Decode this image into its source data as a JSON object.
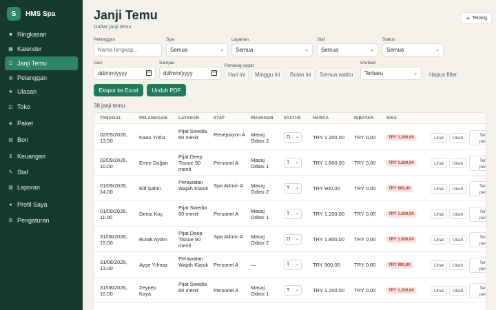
{
  "app": {
    "logo_letter": "S",
    "name": "HMS Spa"
  },
  "sidebar": {
    "items": [
      {
        "label": "Ringkasan",
        "icon": "■",
        "active": false
      },
      {
        "label": "Kalender",
        "icon": "▦",
        "active": false
      },
      {
        "label": "Janji Temu",
        "icon": "☰",
        "active": true
      },
      {
        "label": "Pelanggan",
        "icon": "◍",
        "active": false
      },
      {
        "label": "Ulasan",
        "icon": "★",
        "active": false
      },
      {
        "label": "Toko",
        "icon": "◫",
        "active": false
      },
      {
        "label": "Paket",
        "icon": "◈",
        "active": false
      },
      {
        "label": "Bon",
        "icon": "▤",
        "active": false
      },
      {
        "label": "Keuangan",
        "icon": "$",
        "active": false
      },
      {
        "label": "Staf",
        "icon": "✎",
        "active": false
      },
      {
        "label": "Laporan",
        "icon": "▥",
        "active": false
      },
      {
        "label": "Profil Saya",
        "icon": "●",
        "active": false
      },
      {
        "label": "Pengaturan",
        "icon": "⚙",
        "active": false
      }
    ]
  },
  "header": {
    "title": "Janji Temu",
    "subtitle": "Daftar janji temu",
    "theme_label": "Terang",
    "theme_icon": "☀"
  },
  "filters": {
    "pelanggan": {
      "label": "Pelanggan",
      "placeholder": "Nama lengkap..."
    },
    "spa": {
      "label": "Spa",
      "value": "Semua"
    },
    "layanan": {
      "label": "Layanan",
      "value": "Semua"
    },
    "staf": {
      "label": "Staf",
      "value": "Semua"
    },
    "status": {
      "label": "Status",
      "value": "Semua"
    },
    "dari": {
      "label": "Dari",
      "value": "dd/mm/yyyy"
    },
    "sampai": {
      "label": "Sampai",
      "value": "dd/mm/yyyy"
    },
    "rentang": {
      "label": "Rentang cepat",
      "options": [
        "Hari ini",
        "Minggu ini",
        "Bulan ini",
        "Semua waktu"
      ]
    },
    "urutkan": {
      "label": "Urutkan",
      "value": "Terbaru"
    },
    "reset_label": "Hapus filter"
  },
  "actions": {
    "export_excel": "Ekspor ke Excel",
    "download_pdf": "Unduh PDF"
  },
  "count_text": "38 janji temu",
  "table": {
    "columns": [
      "TANGGAL",
      "PELANGGAN",
      "LAYANAN",
      "STAF",
      "RUANGAN",
      "STATUS",
      "HARGA",
      "DIBAYAR",
      "SISA"
    ],
    "row_actions": {
      "view": "Lihat",
      "edit": "Ubah",
      "pay": "Terima pembayaran"
    },
    "rows": [
      {
        "date": "02/09/2026, 13.00",
        "customer": "Kaan Yıldız",
        "service": "Pijat Swedia 60 menit",
        "staff": "Resepsiyon A",
        "room": "Masaj Odası 2",
        "status": "D",
        "price": "TRY 1.200,00",
        "paid": "TRY 0,00",
        "balance": "TRY 1.200,00"
      },
      {
        "date": "02/09/2026, 10.00",
        "customer": "Emre Doğan",
        "service": "Pijat Deep Tissue 90 menit",
        "staff": "Personel A",
        "room": "Masaj Odası 1",
        "status": "T",
        "price": "TRY 1.800,00",
        "paid": "TRY 0,00",
        "balance": "TRY 1.800,00"
      },
      {
        "date": "01/09/2026, 14.00",
        "customer": "Elif Şahin",
        "service": "Perawatan Wajah Klasik",
        "staff": "Spa Admin A",
        "room": "Masaj Odası 2",
        "status": "T",
        "price": "TRY 900,00",
        "paid": "TRY 0,00",
        "balance": "TRY 900,00"
      },
      {
        "date": "01/09/2026, 11.00",
        "customer": "Deniz Koç",
        "service": "Pijat Swedia 60 menit",
        "staff": "Personel A",
        "room": "Masaj Odası 1",
        "status": "T",
        "price": "TRY 1.200,00",
        "paid": "TRY 0,00",
        "balance": "TRY 1.200,00"
      },
      {
        "date": "31/08/2026, 15.00",
        "customer": "Burak Aydın",
        "service": "Pijat Deep Tissue 90 menit",
        "staff": "Spa Admin A",
        "room": "Masaj Odası 2",
        "status": "D",
        "price": "TRY 1.800,00",
        "paid": "TRY 0,00",
        "balance": "TRY 1.800,00"
      },
      {
        "date": "31/08/2026, 13.00",
        "customer": "Ayşe Yılmaz",
        "service": "Perawatan Wajah Klasik",
        "staff": "Personel A",
        "room": "—",
        "status": "T",
        "price": "TRY 900,00",
        "paid": "TRY 0,00",
        "balance": "TRY 900,00"
      },
      {
        "date": "31/08/2026, 10.00",
        "customer": "Zeynep Kaya",
        "service": "Pijat Swedia 60 menit",
        "staff": "Personel A",
        "room": "Masaj Odası 1",
        "status": "T",
        "price": "TRY 1.200,00",
        "paid": "TRY 0,00",
        "balance": "TRY 1.200,00"
      }
    ]
  },
  "colors": {
    "sidebar_bg": "#173a2f",
    "accent": "#1d7c5e",
    "active_nav": "#2e8467",
    "balance_badge_bg": "#fbe3e1",
    "balance_badge_text": "#b4332c",
    "page_bg": "#f3f1ea"
  }
}
